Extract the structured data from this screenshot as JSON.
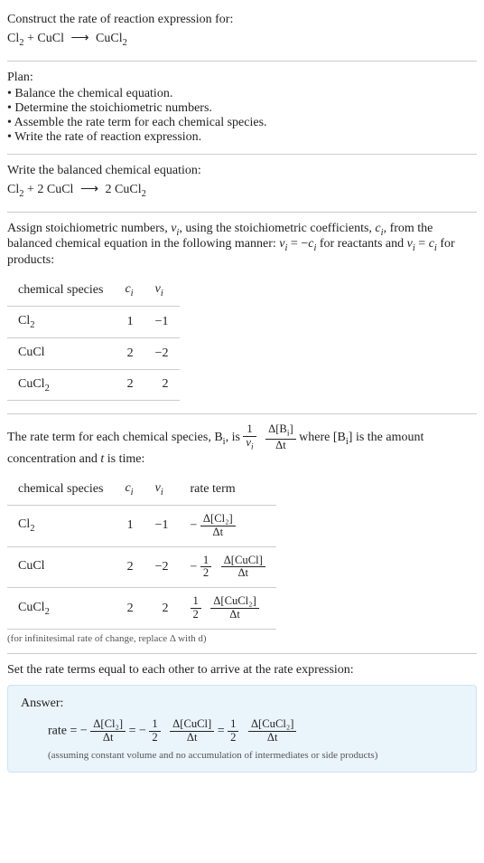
{
  "intro": {
    "construct": "Construct the rate of reaction expression for:",
    "eq_left1": "Cl",
    "eq_left1_sub": "2",
    "plus": " + ",
    "eq_left2": "CuCl",
    "arrow": "⟶",
    "eq_right": "CuCl",
    "eq_right_sub": "2"
  },
  "plan": {
    "heading": "Plan:",
    "items": [
      "Balance the chemical equation.",
      "Determine the stoichiometric numbers.",
      "Assemble the rate term for each chemical species.",
      "Write the rate of reaction expression."
    ]
  },
  "balanced": {
    "heading": "Write the balanced chemical equation:",
    "l1": "Cl",
    "l1s": "2",
    "plus": " + 2 CuCl ",
    "arrow": "⟶",
    "r": " 2 CuCl",
    "rs": "2"
  },
  "stoich_intro": {
    "p1": "Assign stoichiometric numbers, ",
    "nu": "ν",
    "nu_i": "i",
    "p2": ", using the stoichiometric coefficients, ",
    "c": "c",
    "c_i": "i",
    "p3": ", from the balanced chemical equation in the following manner: ",
    "rel1a": "ν",
    "rel1b": "i",
    "rel1c": " = −",
    "rel1d": "c",
    "rel1e": "i",
    "p4": " for reactants and ",
    "rel2a": "ν",
    "rel2b": "i",
    "rel2c": " = ",
    "rel2d": "c",
    "rel2e": "i",
    "p5": " for products:"
  },
  "table1": {
    "h1": "chemical species",
    "h2": "c",
    "h2s": "i",
    "h3": "ν",
    "h3s": "i",
    "rows": [
      {
        "sp": "Cl",
        "sps": "2",
        "c": "1",
        "nu": "−1"
      },
      {
        "sp": "CuCl",
        "sps": "",
        "c": "2",
        "nu": "−2"
      },
      {
        "sp": "CuCl",
        "sps": "2",
        "c": "2",
        "nu": "2"
      }
    ]
  },
  "rate_intro": {
    "p1": "The rate term for each chemical species, B",
    "bi": "i",
    "p2": ", is ",
    "f1n": "1",
    "f1d_a": "ν",
    "f1d_b": "i",
    "f2n_a": "Δ[B",
    "f2n_b": "i",
    "f2n_c": "]",
    "f2d": "Δt",
    "p3": " where [B",
    "p3b": "i",
    "p3c": "] is the amount concentration and ",
    "t": "t",
    "p4": " is time:"
  },
  "table2": {
    "h1": "chemical species",
    "h2": "c",
    "h2s": "i",
    "h3": "ν",
    "h3s": "i",
    "h4": "rate term",
    "rows": [
      {
        "sp": "Cl",
        "sps": "2",
        "c": "1",
        "nu": "−1",
        "pre": "−",
        "fa_n": "",
        "fa_d": "",
        "fb_n": "Δ[Cl₂]",
        "fb_d": "Δt"
      },
      {
        "sp": "CuCl",
        "sps": "",
        "c": "2",
        "nu": "−2",
        "pre": "−",
        "fa_n": "1",
        "fa_d": "2",
        "fb_n": "Δ[CuCl]",
        "fb_d": "Δt"
      },
      {
        "sp": "CuCl",
        "sps": "2",
        "c": "2",
        "nu": "2",
        "pre": "",
        "fa_n": "1",
        "fa_d": "2",
        "fb_n": "Δ[CuCl₂]",
        "fb_d": "Δt"
      }
    ],
    "note": "(for infinitesimal rate of change, replace Δ with d)"
  },
  "final": {
    "heading": "Set the rate terms equal to each other to arrive at the rate expression:"
  },
  "answer": {
    "label": "Answer:",
    "rate_word": "rate = −",
    "t1_n": "Δ[Cl₂]",
    "t1_d": "Δt",
    "eq1": " = −",
    "h1_n": "1",
    "h1_d": "2",
    "t2_n": "Δ[CuCl]",
    "t2_d": "Δt",
    "eq2": " = ",
    "h2_n": "1",
    "h2_d": "2",
    "t3_n": "Δ[CuCl₂]",
    "t3_d": "Δt",
    "assume": "(assuming constant volume and no accumulation of intermediates or side products)"
  },
  "chart_data": {
    "type": "table",
    "tables": [
      {
        "title": "Stoichiometric numbers",
        "columns": [
          "chemical species",
          "c_i",
          "ν_i"
        ],
        "rows": [
          [
            "Cl2",
            1,
            -1
          ],
          [
            "CuCl",
            2,
            -2
          ],
          [
            "CuCl2",
            2,
            2
          ]
        ]
      },
      {
        "title": "Rate terms",
        "columns": [
          "chemical species",
          "c_i",
          "ν_i",
          "rate term"
        ],
        "rows": [
          [
            "Cl2",
            1,
            -1,
            "-Δ[Cl2]/Δt"
          ],
          [
            "CuCl",
            2,
            -2,
            "-(1/2) Δ[CuCl]/Δt"
          ],
          [
            "CuCl2",
            2,
            2,
            "(1/2) Δ[CuCl2]/Δt"
          ]
        ]
      }
    ]
  }
}
